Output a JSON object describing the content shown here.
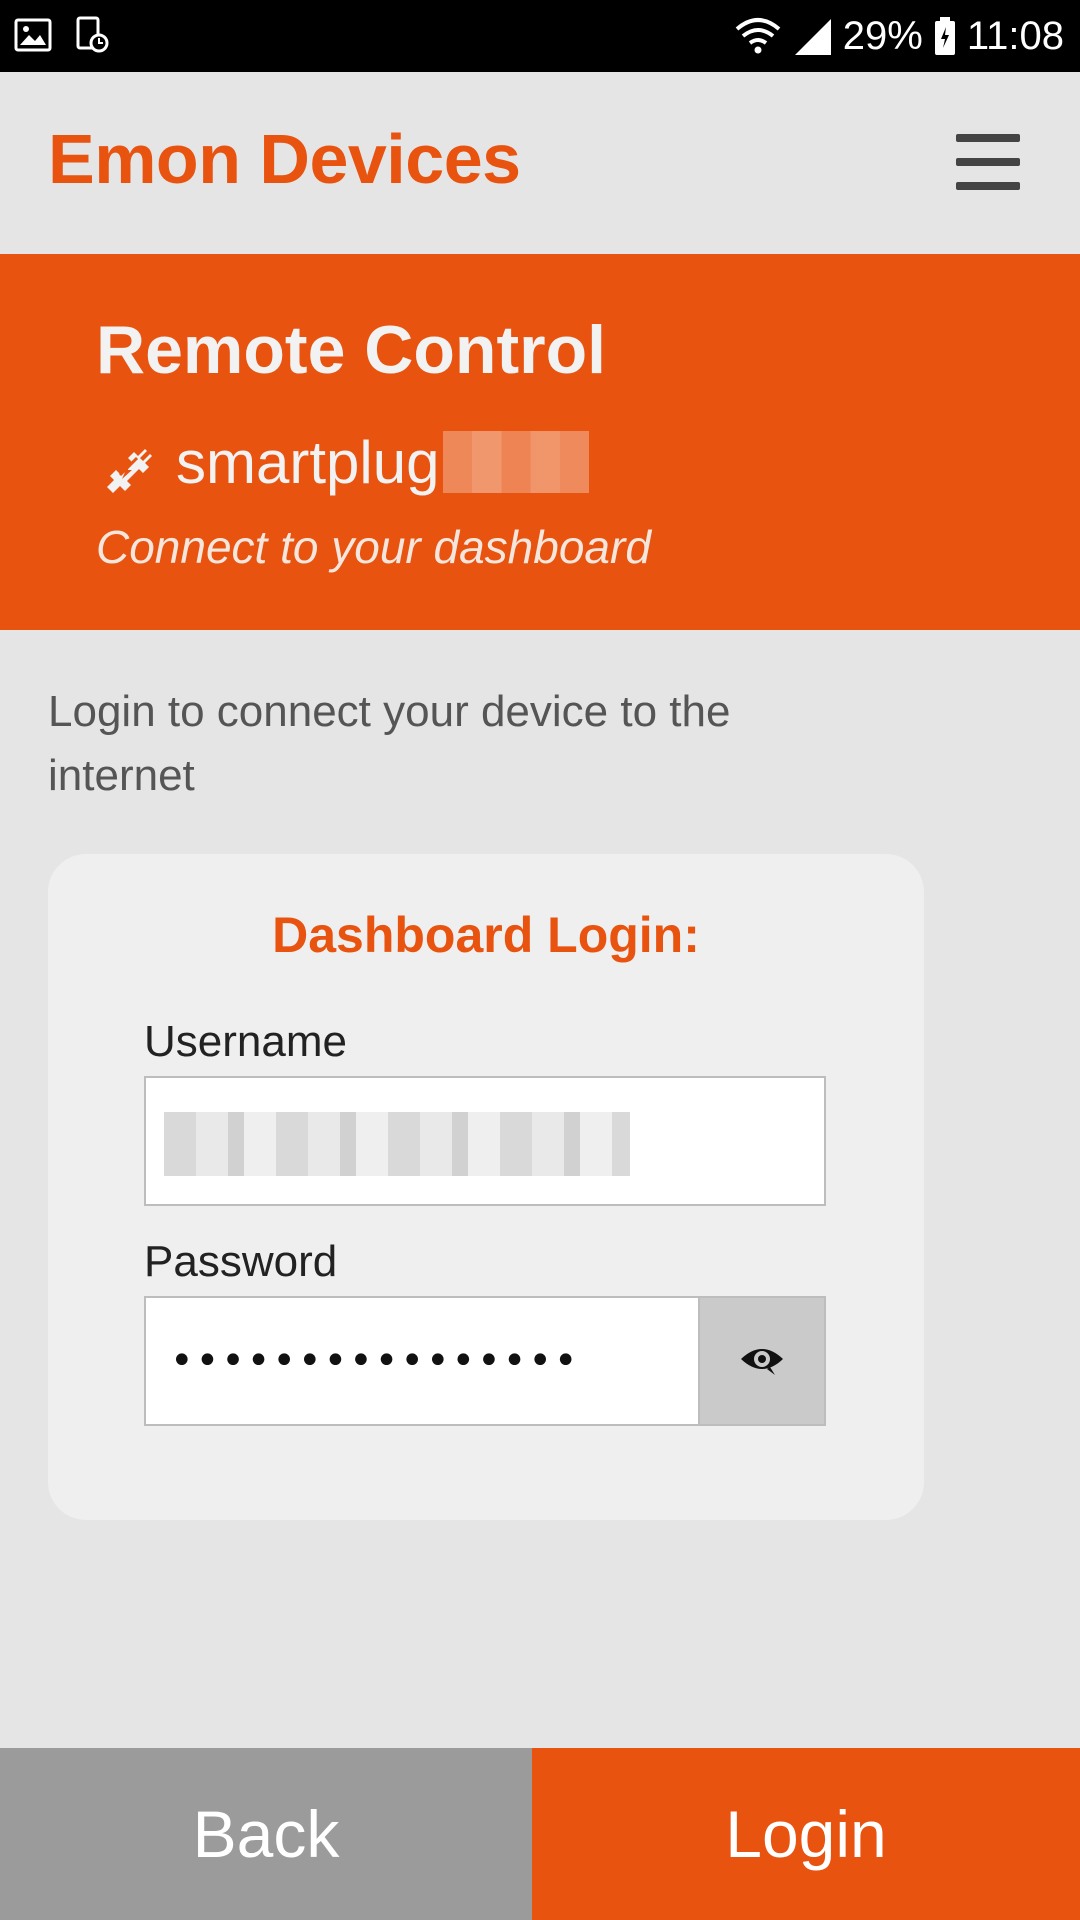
{
  "status_bar": {
    "battery": "29%",
    "time": "11:08",
    "icons": [
      "image-icon",
      "screenshot-icon",
      "wifi-icon",
      "signal-icon",
      "battery-icon"
    ]
  },
  "app_bar": {
    "title": "Emon Devices",
    "menu_icon": "hamburger-menu-icon"
  },
  "hero": {
    "title": "Remote Control",
    "device_icon": "plug-icon",
    "device_name": "smartplug",
    "subtitle": "Connect to your dashboard"
  },
  "intro": {
    "text": "Login to connect your device to the internet"
  },
  "login_card": {
    "title": "Dashboard Login:",
    "username_label": "Username",
    "username_value": "",
    "password_label": "Password",
    "password_value": "••••••••••••••••",
    "show_password_icon": "eye-icon"
  },
  "actions": {
    "back_label": "Back",
    "login_label": "Login"
  },
  "colors": {
    "accent": "#e85310",
    "background": "#e5e5e5",
    "card": "#efefef",
    "back_button": "#9b9b9b"
  }
}
